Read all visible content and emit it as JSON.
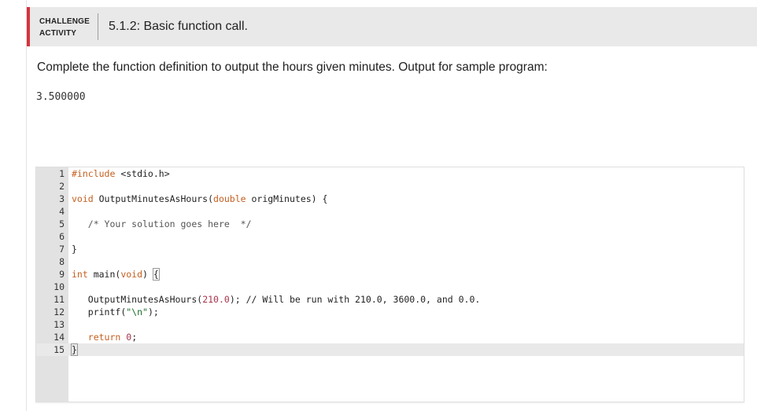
{
  "header": {
    "label_line1": "CHALLENGE",
    "label_line2": "ACTIVITY",
    "title": "5.1.2: Basic function call."
  },
  "prompt": "Complete the function definition to output the hours given minutes. Output for sample program:",
  "sample_output": "3.500000",
  "editor": {
    "line_numbers": [
      "1",
      "2",
      "3",
      "4",
      "5",
      "6",
      "7",
      "8",
      "9",
      "10",
      "11",
      "12",
      "13",
      "14",
      "15"
    ],
    "active_line": 15,
    "lines": {
      "l1": {
        "pp": "#include",
        "rest": " <stdio.h>"
      },
      "l3": {
        "kw1": "void",
        "name": " OutputMinutesAsHours(",
        "kw2": "double",
        "rest": " origMinutes) {"
      },
      "l5": {
        "indent": "   ",
        "comment": "/* Your solution goes here  */"
      },
      "l7": {
        "text": "}"
      },
      "l9": {
        "kw1": "int",
        "name": " main(",
        "kw2": "void",
        "rest": ") ",
        "brace": "{"
      },
      "l11": {
        "indent": "   ",
        "call": "OutputMinutesAsHours(",
        "num": "210.0",
        "rest": "); // Will be run with 210.0, 3600.0, and 0.0."
      },
      "l12": {
        "indent": "   ",
        "call": "printf(",
        "str": "\"\\n\"",
        "rest": ");"
      },
      "l14": {
        "indent": "   ",
        "kw": "return",
        "sp": " ",
        "num": "0",
        "rest": ";"
      },
      "l15": {
        "text": "}"
      }
    }
  }
}
